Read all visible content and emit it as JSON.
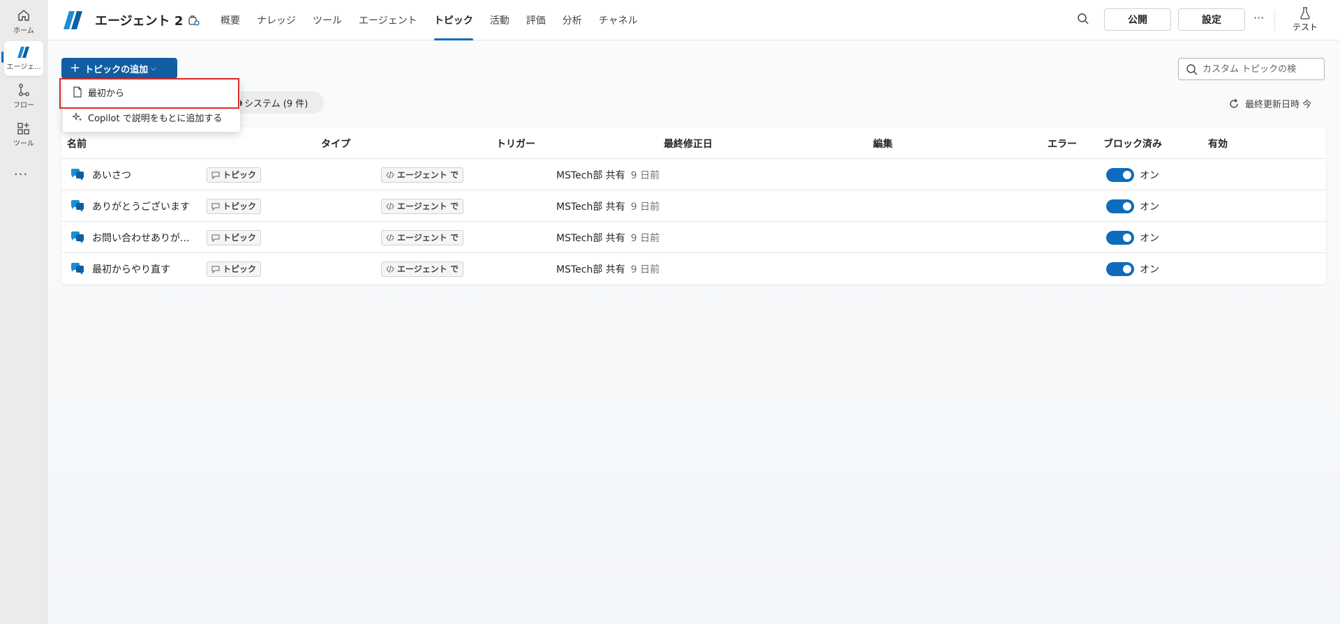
{
  "rail": {
    "items": [
      {
        "label": "ホーム",
        "icon": "home-icon"
      },
      {
        "label": "エージェ...",
        "icon": "agent-icon"
      },
      {
        "label": "フロー",
        "icon": "flow-icon"
      },
      {
        "label": "ツール",
        "icon": "tools-icon"
      }
    ],
    "more": "···"
  },
  "header": {
    "title": "エージェント 2",
    "tabs": [
      "概要",
      "ナレッジ",
      "ツール",
      "エージェント",
      "トピック",
      "活動",
      "評価",
      "分析",
      "チャネル"
    ],
    "active_tab": "トピック",
    "publish_label": "公開",
    "settings_label": "設定",
    "more_label": "···",
    "test_label": "テスト"
  },
  "toolbar": {
    "add_topic_label": "トピックの追加",
    "system_filter_label": "システム (9 件)",
    "search_placeholder": "カスタム トピックの検",
    "last_updated_label": "最終更新日時 今"
  },
  "dropdown": {
    "items": [
      "最初から",
      "Copilot で説明をもとに追加する"
    ]
  },
  "table": {
    "columns": [
      "名前",
      "タイプ",
      "トリガー",
      "最終修正日",
      "編集",
      "エラー",
      "ブロック済み",
      "有効"
    ],
    "rows": [
      {
        "name": "あいさつ",
        "type": "トピック",
        "trigger": "エージェント で",
        "modified_by": "MSTech部 共有",
        "modified_when": "9 日前",
        "enabled": "オン"
      },
      {
        "name": "ありがとうございます",
        "type": "トピック",
        "trigger": "エージェント で",
        "modified_by": "MSTech部 共有",
        "modified_when": "9 日前",
        "enabled": "オン"
      },
      {
        "name": "お問い合わせありが...",
        "type": "トピック",
        "trigger": "エージェント で",
        "modified_by": "MSTech部 共有",
        "modified_when": "9 日前",
        "enabled": "オン"
      },
      {
        "name": "最初からやり直す",
        "type": "トピック",
        "trigger": "エージェント で",
        "modified_by": "MSTech部 共有",
        "modified_when": "9 日前",
        "enabled": "オン"
      }
    ]
  },
  "colors": {
    "accent": "#0f6cbd",
    "primary_button": "#115ea3",
    "highlight_border": "#d62a2a"
  }
}
